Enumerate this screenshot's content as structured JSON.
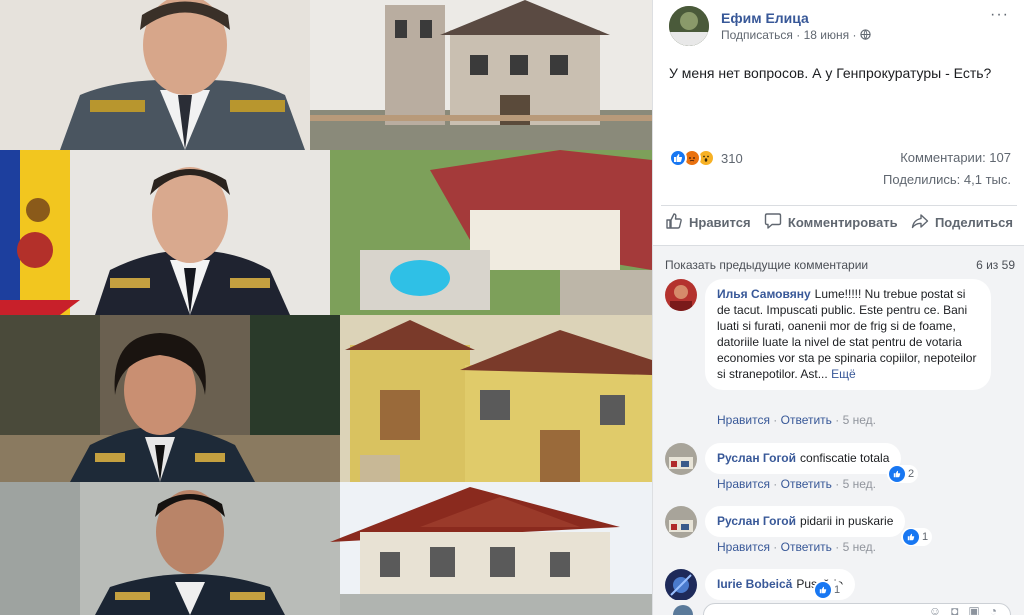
{
  "post": {
    "author": "Ефим Елица",
    "subscribe": "Подписаться",
    "date": "18 июня",
    "more": "···",
    "text": "У меня нет вопросов. А у Генпрокуратуры - Есть?",
    "reaction_count": "310",
    "comments_count": "Комментарии: 107",
    "shares_count": "Поделились: 4,1 тыс.",
    "reaction_icons": [
      "like-icon",
      "angry-icon",
      "wow-icon"
    ]
  },
  "actions": {
    "like": "Нравится",
    "comment": "Комментировать",
    "share": "Поделиться"
  },
  "comments_section": {
    "show_previous": "Показать предыдущие комментарии",
    "page_count": "6 из 59"
  },
  "comments": [
    {
      "name": "Илья Самовяну",
      "text": "Lume!!!!! Nu trebue postat si de tacut. Impuscati public. Este pentru ce. Bani luati si furati, oanenii mor de frig si de foame, datoriile luate la nivel de stat pentru de votaria economies vor sta pe spinaria copiilor, nepoteilor si stranepotilor. Ast...",
      "more": "Ещё",
      "like": "Нравится",
      "reply": "Ответить",
      "time": "5 нед.",
      "likes": ""
    },
    {
      "name": "Руслан Гогой",
      "text": "confiscatie totala",
      "more": "",
      "like": "Нравится",
      "reply": "Ответить",
      "time": "5 нед.",
      "likes": "2"
    },
    {
      "name": "Руслан Гогой",
      "text": "pidarii in puskarie",
      "more": "",
      "like": "Нравится",
      "reply": "Ответить",
      "time": "5 нед.",
      "likes": "1"
    },
    {
      "name": "Iurie Bobeică",
      "text": "Pușcărie",
      "more": "",
      "like": "",
      "reply": "",
      "time": "",
      "likes": "1"
    }
  ],
  "colors": {
    "link": "#385898",
    "like_blue": "#1877f2",
    "muted": "#606770",
    "comments_bg": "#f2f3f5"
  }
}
